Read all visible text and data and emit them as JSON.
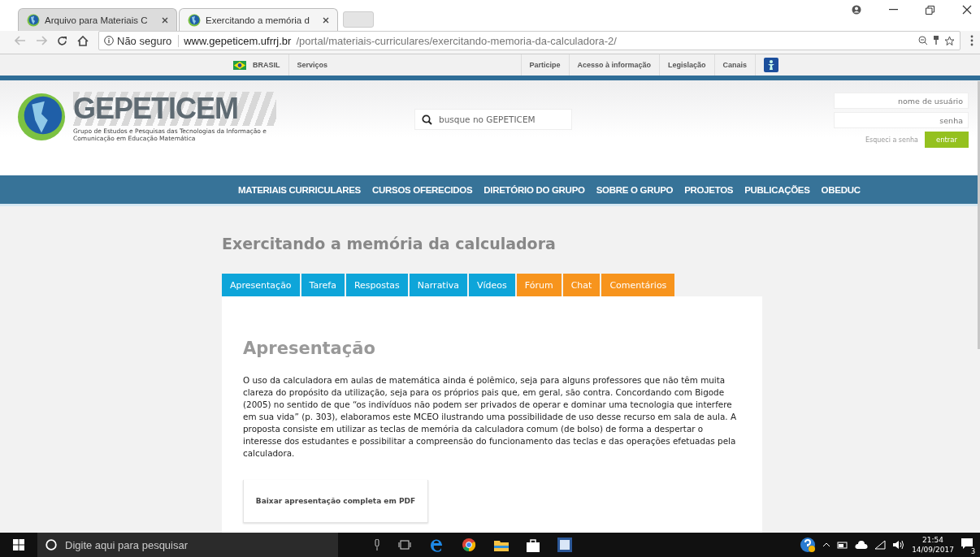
{
  "browser": {
    "tabs": [
      {
        "title": "Arquivo para Materiais C",
        "selected": false
      },
      {
        "title": "Exercitando a memória d",
        "selected": true
      }
    ],
    "security": "Não seguro",
    "url_host": "www.gepeticem.ufrrj.br",
    "url_path": "/portal/materiais-curriculares/exercitando-memoria-da-calculadora-2/"
  },
  "gov_bar": {
    "country": "BRASIL",
    "left_links": [
      "Serviços"
    ],
    "right_links": [
      "Participe",
      "Acesso à informação",
      "Legislação",
      "Canais"
    ]
  },
  "header": {
    "logo_text": "GEPETICEM",
    "logo_subtitle": "Grupo de Estudos e Pesquisas das Tecnologias da Informação e Comunicação em Educação Matemática",
    "search": {
      "placeholder": "busque no GEPETICEM"
    },
    "login": {
      "username_placeholder": "nome de usuário",
      "password_placeholder": "senha",
      "forgot": "Esqueci a senha",
      "submit": "entrar"
    }
  },
  "nav": [
    "MATERIAIS CURRICULARES",
    "CURSOS OFERECIDOS",
    "DIRETÓRIO DO GRUPO",
    "SOBRE O GRUPO",
    "PROJETOS",
    "PUBLICAÇÕES",
    "OBEDUC"
  ],
  "page": {
    "title": "Exercitando a memória da calculadora",
    "tabs": [
      {
        "label": "Apresentação",
        "color": "#0ea5d9"
      },
      {
        "label": "Tarefa",
        "color": "#0ea5d9"
      },
      {
        "label": "Respostas",
        "color": "#0ea5d9"
      },
      {
        "label": "Narrativa",
        "color": "#0ea5d9"
      },
      {
        "label": "Vídeos",
        "color": "#0ea5d9"
      },
      {
        "label": "Fórum",
        "color": "#f7941d"
      },
      {
        "label": "Chat",
        "color": "#f7941d"
      },
      {
        "label": "Comentários",
        "color": "#f7941d"
      }
    ],
    "section_title": "Apresentação",
    "paragraph": "O uso da calculadora em aulas de matemática ainda é polêmico, seja para alguns professores que não têm muita clareza do propósito da utilização, seja para os próprios pais que, em geral, são contra. Concordando com Bigode (2005) no sentido de que “os indivíduos não podem ser privados de operar e dominar uma tecnologia que interfere em sua vida” (p. 303), elaboramos este MCEO ilustrando uma possibilidade de uso desse recurso em sala de aula. A proposta consiste em utilizar as teclas de memória da calculadora comum (de bolso) de forma a despertar o interesse dos estudantes e possibilitar a compreensão do funcionamento das teclas e das operações efetuadas pela calculadora.",
    "download": "Baixar apresentação completa em PDF"
  },
  "taskbar": {
    "search_placeholder": "Digite aqui para pesquisar",
    "time": "21:54",
    "date": "14/09/2017",
    "notifications": "3"
  }
}
